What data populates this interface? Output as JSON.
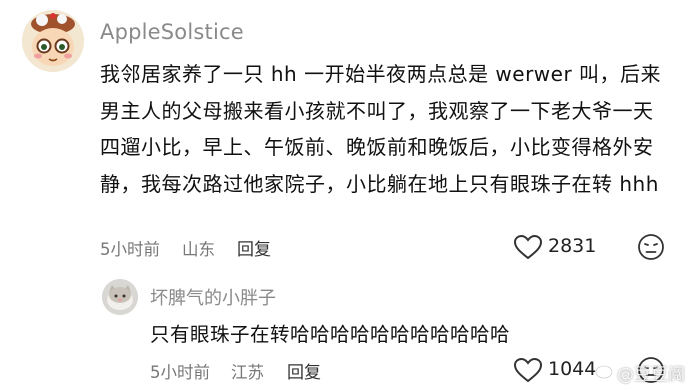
{
  "comment": {
    "username": "AppleSolstice",
    "text": "我邻居家养了一只 hh 一开始半夜两点总是 werwer 叫，后来男主人的父母搬来看小孩就不叫了，我观察了一下老大爷一天四遛小比，早上、午饭前、晚饭前和晚饭后，小比变得格外安静，我每次路过他家院子，小比躺在地上只有眼珠子在转 hhh",
    "time": "5小时前",
    "location": "山东",
    "reply_label": "回复",
    "likes": "2831"
  },
  "reply": {
    "username": "坏脾气的小胖子",
    "text": "只有眼珠子在转哈哈哈哈哈哈哈哈哈哈哈",
    "time": "5小时前",
    "location": "江苏",
    "reply_label": "回复",
    "likes": "1044"
  },
  "watermark": "@豆豆阅"
}
